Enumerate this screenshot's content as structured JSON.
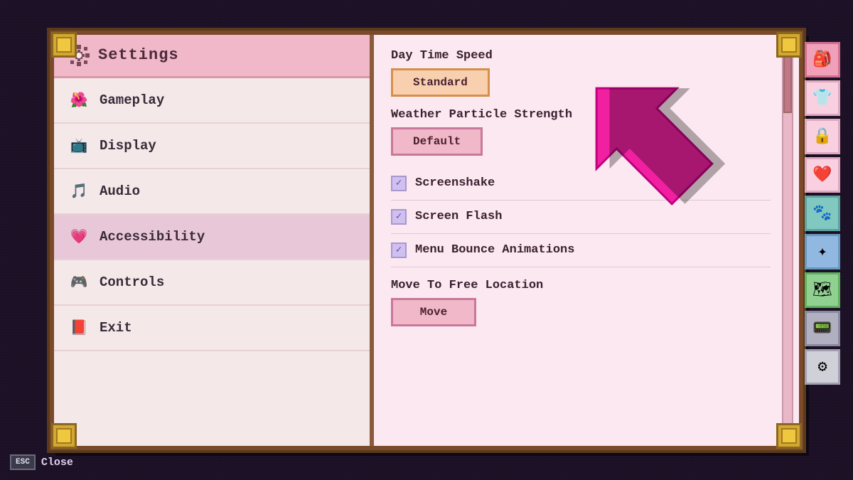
{
  "header": {
    "title": "Settings",
    "gear_icon": "⚙"
  },
  "menu": {
    "items": [
      {
        "id": "gameplay",
        "label": "Gameplay",
        "icon": "🌸",
        "active": false
      },
      {
        "id": "display",
        "label": "Display",
        "icon": "📺",
        "active": false
      },
      {
        "id": "audio",
        "label": "Audio",
        "icon": "🎵",
        "active": false
      },
      {
        "id": "accessibility",
        "label": "Accessibility",
        "icon": "💗",
        "active": true
      },
      {
        "id": "controls",
        "label": "Controls",
        "icon": "🎮",
        "active": false
      },
      {
        "id": "exit",
        "label": "Exit",
        "icon": "📕",
        "active": false
      }
    ]
  },
  "settings": {
    "day_time_speed": {
      "label": "Day Time Speed",
      "value": "Standard"
    },
    "weather_particles": {
      "label": "Weather Particle Strength",
      "value": "Default"
    },
    "screenshake": {
      "label": "Screenshake",
      "checked": true
    },
    "screen_flash": {
      "label": "Screen Flash",
      "checked": true
    },
    "menu_bounce": {
      "label": "Menu Bounce Animations",
      "checked": true
    },
    "move_to_free": {
      "label": "Move To Free Location",
      "button": "Move"
    }
  },
  "esc": {
    "key": "ESC",
    "label": "Close"
  },
  "sidebar_icons": [
    "🎒",
    "👕",
    "🔒",
    "❤",
    "🐾",
    "✦",
    "🗺",
    "📟",
    "⚙"
  ],
  "corners": [
    "tl",
    "tr",
    "bl",
    "br"
  ]
}
